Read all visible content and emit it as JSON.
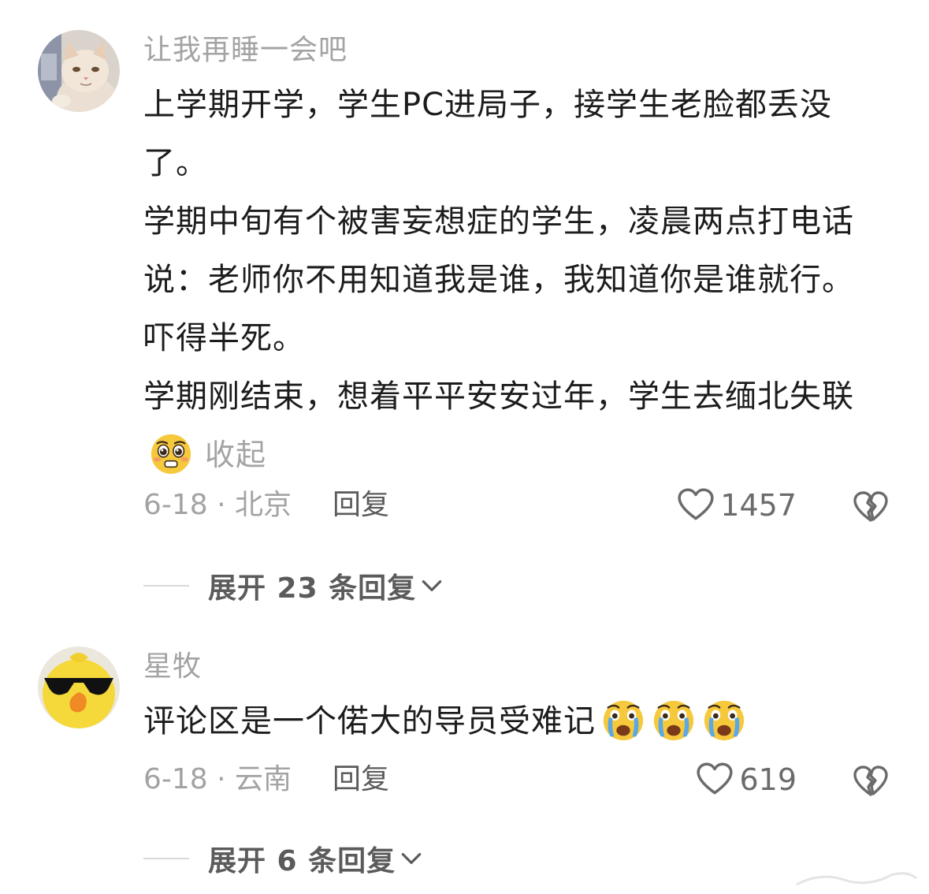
{
  "comments": [
    {
      "username": "让我再睡一会吧",
      "avatar": "cat-avatar",
      "lines": [
        "上学期开学，学生PC进局子，接学生老脸都丢没了。",
        "学期中旬有个被害妄想症的学生，凌晨两点打电话说：老师你不用知道我是谁，我知道你是谁就行。吓得半死。",
        "学期刚结束，想着平平安安过年，学生去缅北失联"
      ],
      "trailing_emoji": "pleading-face-emoji",
      "collapse_label": "收起",
      "date_location": "6-18 · 北京",
      "reply_label": "回复",
      "like_count": "1457",
      "expand_label": "展开 23 条回复"
    },
    {
      "username": "星牧",
      "avatar": "duck-sunglasses-avatar",
      "lines": [
        "评论区是一个偌大的导员受难记"
      ],
      "trailing_emojis": [
        "crying-face-emoji",
        "crying-face-emoji",
        "crying-face-emoji"
      ],
      "date_location": "6-18 · 云南",
      "reply_label": "回复",
      "like_count": "619",
      "expand_label": "展开 6 条回复"
    }
  ],
  "icons": {
    "like": "heart-outline-icon",
    "dislike": "broken-heart-icon",
    "expand": "chevron-down-icon"
  },
  "colors": {
    "muted_text": "#a3a3a3",
    "body_text": "#1c1c1c",
    "action_text": "#5b5b5b"
  }
}
